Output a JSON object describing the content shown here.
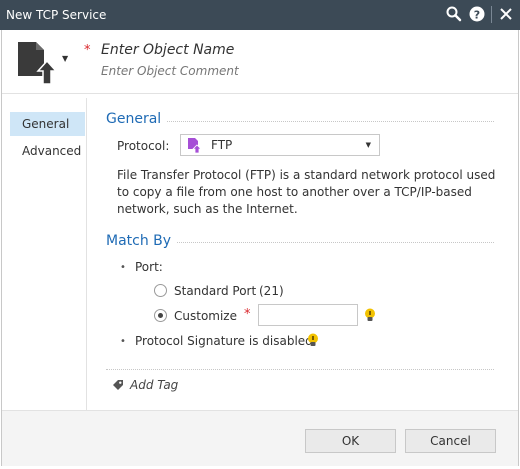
{
  "window": {
    "title": "New TCP Service"
  },
  "header": {
    "name_placeholder": "Enter Object Name",
    "comment_placeholder": "Enter Object Comment",
    "required_mark": "*"
  },
  "sidebar": {
    "items": [
      {
        "label": "General",
        "active": true
      },
      {
        "label": "Advanced",
        "active": false
      }
    ]
  },
  "general": {
    "title": "General",
    "protocol_label": "Protocol:",
    "protocol_value": "FTP",
    "description": "File Transfer Protocol (FTP) is a standard network protocol used to copy a file from one host to another over a TCP/IP-based network, such as the Internet."
  },
  "match_by": {
    "title": "Match By",
    "bullet": "•",
    "port_label": "Port:",
    "standard_port_label": "Standard Port",
    "standard_port_value": "(21)",
    "customize_label": "Customize",
    "customize_value": "",
    "selected_option": "customize",
    "signature_label": "Protocol Signature is disabled"
  },
  "tags": {
    "add_tag_label": "Add Tag"
  },
  "footer": {
    "ok_label": "OK",
    "cancel_label": "Cancel"
  },
  "icons": [
    "search-icon",
    "help-icon",
    "close-icon",
    "object-icon",
    "chevron-down-icon",
    "ftp-icon",
    "lightbulb-icon",
    "tag-icon"
  ],
  "colors": {
    "titlebar": "#3c4a56",
    "accent": "#1f6bb5",
    "required": "#d9262b",
    "active_nav": "#cfe6f7",
    "ftp_icon": "#a64fd6",
    "bulb": "#f2c200"
  }
}
